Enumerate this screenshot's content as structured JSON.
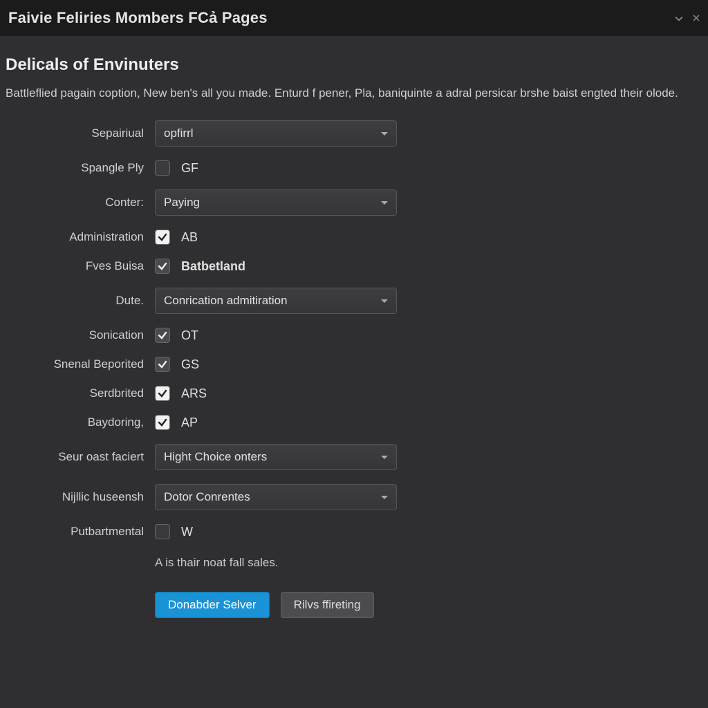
{
  "window": {
    "title": "Faivie Feliries Mombers FCả Pages"
  },
  "page": {
    "heading": "Delicals of Envinuters",
    "description": "Battleflied pagain coption, New ben's all you made. Enturd f pener, Pla, baniquinte a adral persicar brshe baist engted their olode."
  },
  "form": {
    "sepairiual": {
      "label": "Sepairiual",
      "value": "opfirrl"
    },
    "spangle_ply": {
      "label": "Spangle Ply",
      "checked": false,
      "code": "GF"
    },
    "conter": {
      "label": "Conter:",
      "value": "Paying"
    },
    "administration": {
      "label": "Administration",
      "checked": true,
      "code": "AB"
    },
    "fves_buisa": {
      "label": "Fves Buisa",
      "checked": true,
      "dark": true,
      "code": "Batbetland",
      "bold": true
    },
    "dute": {
      "label": "Dute.",
      "value": "Conrication admitiration"
    },
    "sonication": {
      "label": "Sonication",
      "checked": true,
      "dark": true,
      "code": "OT"
    },
    "snenal": {
      "label": "Snenal Beporited",
      "checked": true,
      "dark": true,
      "code": "GS"
    },
    "serdbrited": {
      "label": "Serdbrited",
      "checked": true,
      "code": "ARS"
    },
    "baydoring": {
      "label": "Baydoring,",
      "checked": true,
      "code": "AP"
    },
    "seur_oast": {
      "label": "Seur oast faciert",
      "value": "Hight Choice onters"
    },
    "nijllic": {
      "label": "Nijllic huseensh",
      "value": "Dotor Conrentes"
    },
    "putbartmental": {
      "label": "Putbartmental",
      "checked": false,
      "code": "W"
    },
    "helper": "A   is thair noat fall sales."
  },
  "buttons": {
    "primary": "Donabder Selver",
    "secondary": "Rilvs ffireting"
  }
}
